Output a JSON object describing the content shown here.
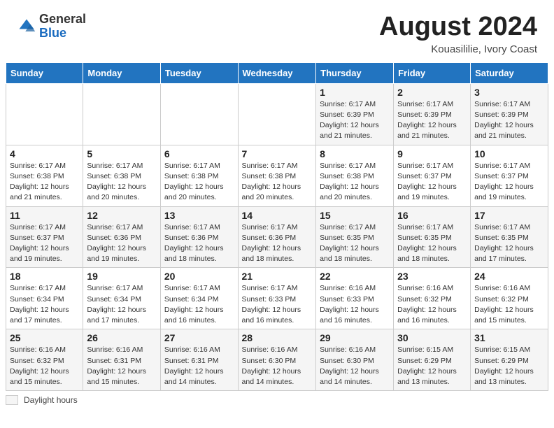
{
  "header": {
    "logo_general": "General",
    "logo_blue": "Blue",
    "month_year": "August 2024",
    "location": "Kouasililie, Ivory Coast"
  },
  "days_of_week": [
    "Sunday",
    "Monday",
    "Tuesday",
    "Wednesday",
    "Thursday",
    "Friday",
    "Saturday"
  ],
  "weeks": [
    [
      {
        "day": "",
        "info": ""
      },
      {
        "day": "",
        "info": ""
      },
      {
        "day": "",
        "info": ""
      },
      {
        "day": "",
        "info": ""
      },
      {
        "day": "1",
        "info": "Sunrise: 6:17 AM\nSunset: 6:39 PM\nDaylight: 12 hours and 21 minutes."
      },
      {
        "day": "2",
        "info": "Sunrise: 6:17 AM\nSunset: 6:39 PM\nDaylight: 12 hours and 21 minutes."
      },
      {
        "day": "3",
        "info": "Sunrise: 6:17 AM\nSunset: 6:39 PM\nDaylight: 12 hours and 21 minutes."
      }
    ],
    [
      {
        "day": "4",
        "info": "Sunrise: 6:17 AM\nSunset: 6:38 PM\nDaylight: 12 hours and 21 minutes."
      },
      {
        "day": "5",
        "info": "Sunrise: 6:17 AM\nSunset: 6:38 PM\nDaylight: 12 hours and 20 minutes."
      },
      {
        "day": "6",
        "info": "Sunrise: 6:17 AM\nSunset: 6:38 PM\nDaylight: 12 hours and 20 minutes."
      },
      {
        "day": "7",
        "info": "Sunrise: 6:17 AM\nSunset: 6:38 PM\nDaylight: 12 hours and 20 minutes."
      },
      {
        "day": "8",
        "info": "Sunrise: 6:17 AM\nSunset: 6:38 PM\nDaylight: 12 hours and 20 minutes."
      },
      {
        "day": "9",
        "info": "Sunrise: 6:17 AM\nSunset: 6:37 PM\nDaylight: 12 hours and 19 minutes."
      },
      {
        "day": "10",
        "info": "Sunrise: 6:17 AM\nSunset: 6:37 PM\nDaylight: 12 hours and 19 minutes."
      }
    ],
    [
      {
        "day": "11",
        "info": "Sunrise: 6:17 AM\nSunset: 6:37 PM\nDaylight: 12 hours and 19 minutes."
      },
      {
        "day": "12",
        "info": "Sunrise: 6:17 AM\nSunset: 6:36 PM\nDaylight: 12 hours and 19 minutes."
      },
      {
        "day": "13",
        "info": "Sunrise: 6:17 AM\nSunset: 6:36 PM\nDaylight: 12 hours and 18 minutes."
      },
      {
        "day": "14",
        "info": "Sunrise: 6:17 AM\nSunset: 6:36 PM\nDaylight: 12 hours and 18 minutes."
      },
      {
        "day": "15",
        "info": "Sunrise: 6:17 AM\nSunset: 6:35 PM\nDaylight: 12 hours and 18 minutes."
      },
      {
        "day": "16",
        "info": "Sunrise: 6:17 AM\nSunset: 6:35 PM\nDaylight: 12 hours and 18 minutes."
      },
      {
        "day": "17",
        "info": "Sunrise: 6:17 AM\nSunset: 6:35 PM\nDaylight: 12 hours and 17 minutes."
      }
    ],
    [
      {
        "day": "18",
        "info": "Sunrise: 6:17 AM\nSunset: 6:34 PM\nDaylight: 12 hours and 17 minutes."
      },
      {
        "day": "19",
        "info": "Sunrise: 6:17 AM\nSunset: 6:34 PM\nDaylight: 12 hours and 17 minutes."
      },
      {
        "day": "20",
        "info": "Sunrise: 6:17 AM\nSunset: 6:34 PM\nDaylight: 12 hours and 16 minutes."
      },
      {
        "day": "21",
        "info": "Sunrise: 6:17 AM\nSunset: 6:33 PM\nDaylight: 12 hours and 16 minutes."
      },
      {
        "day": "22",
        "info": "Sunrise: 6:16 AM\nSunset: 6:33 PM\nDaylight: 12 hours and 16 minutes."
      },
      {
        "day": "23",
        "info": "Sunrise: 6:16 AM\nSunset: 6:32 PM\nDaylight: 12 hours and 16 minutes."
      },
      {
        "day": "24",
        "info": "Sunrise: 6:16 AM\nSunset: 6:32 PM\nDaylight: 12 hours and 15 minutes."
      }
    ],
    [
      {
        "day": "25",
        "info": "Sunrise: 6:16 AM\nSunset: 6:32 PM\nDaylight: 12 hours and 15 minutes."
      },
      {
        "day": "26",
        "info": "Sunrise: 6:16 AM\nSunset: 6:31 PM\nDaylight: 12 hours and 15 minutes."
      },
      {
        "day": "27",
        "info": "Sunrise: 6:16 AM\nSunset: 6:31 PM\nDaylight: 12 hours and 14 minutes."
      },
      {
        "day": "28",
        "info": "Sunrise: 6:16 AM\nSunset: 6:30 PM\nDaylight: 12 hours and 14 minutes."
      },
      {
        "day": "29",
        "info": "Sunrise: 6:16 AM\nSunset: 6:30 PM\nDaylight: 12 hours and 14 minutes."
      },
      {
        "day": "30",
        "info": "Sunrise: 6:15 AM\nSunset: 6:29 PM\nDaylight: 12 hours and 13 minutes."
      },
      {
        "day": "31",
        "info": "Sunrise: 6:15 AM\nSunset: 6:29 PM\nDaylight: 12 hours and 13 minutes."
      }
    ]
  ],
  "legend": {
    "label": "Daylight hours"
  }
}
